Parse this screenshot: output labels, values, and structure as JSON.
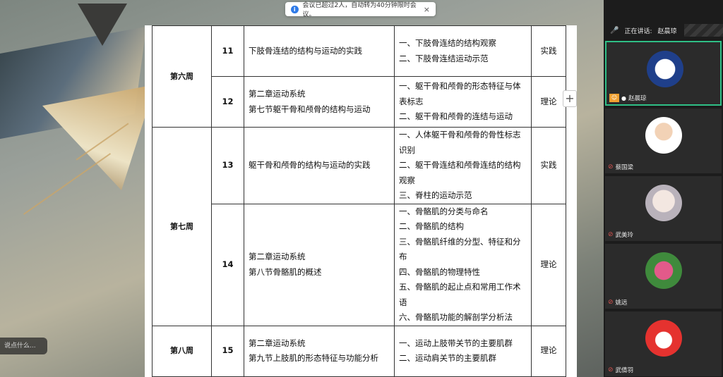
{
  "notification": {
    "text": "会议已超过2人，自动转为40分钟限时会议。",
    "close": "×"
  },
  "share": {
    "comment_placeholder": "说点什么...",
    "add_button": "+"
  },
  "schedule": {
    "rows": [
      {
        "week": "第六周",
        "week_rowspan": 2,
        "num": "11",
        "content": [
          "下肢骨连结的结构与运动的实践"
        ],
        "points": [
          "一、下肢骨连结的结构观察",
          "二、下肢骨连结运动示范"
        ],
        "type": "实践"
      },
      {
        "num": "12",
        "content": [
          "第二章运动系统",
          "第七节躯干骨和颅骨的结构与运动"
        ],
        "points": [
          "一、躯干骨和颅骨的形态特征与体表标志",
          "二、躯干骨和颅骨的连结与运动"
        ],
        "type": "理论"
      },
      {
        "week": "第七周",
        "week_rowspan": 2,
        "num": "13",
        "content": [
          "躯干骨和颅骨的结构与运动的实践"
        ],
        "points": [
          "一、人体躯干骨和颅骨的骨性标志识别",
          "二、躯干骨连结和颅骨连结的结构观察",
          "三、脊柱的运动示范"
        ],
        "type": "实践"
      },
      {
        "num": "14",
        "content": [
          "第二章运动系统",
          "第八节骨骼肌的概述"
        ],
        "points": [
          "一、骨骼肌的分类与命名",
          "二、骨骼肌的结构",
          "三、骨骼肌纤维的分型、特征和分布",
          "四、骨骼肌的物理特性",
          "五、骨骼肌的起止点和常用工作术语",
          "六、骨骼肌功能的解剖学分析法"
        ],
        "type": "理论"
      },
      {
        "week": "第八周",
        "week_rowspan": 1,
        "num": "15",
        "content": [
          "第二章运动系统",
          "第九节上肢肌的形态特征与功能分析"
        ],
        "points": [
          "一、运动上肢带关节的主要肌群",
          "二、运动肩关节的主要肌群"
        ],
        "type": "理论"
      }
    ]
  },
  "panel": {
    "speaking_label": "正在讲话:",
    "speaking_name": "赵晨琼",
    "participants": [
      {
        "name": "赵晨琼",
        "avatar": "school-logo",
        "host": true,
        "muted": false,
        "active": true
      },
      {
        "name": "蔡国梁",
        "avatar": "person-photo",
        "host": false,
        "muted": true,
        "active": false
      },
      {
        "name": "武美玲",
        "avatar": "anime-girl",
        "host": false,
        "muted": true,
        "active": false
      },
      {
        "name": "姚远",
        "avatar": "flower-photo",
        "host": false,
        "muted": true,
        "active": false
      },
      {
        "name": "武倩羽",
        "avatar": "red-toy",
        "host": false,
        "muted": true,
        "active": false
      }
    ],
    "colors": {
      "active_border": "#2fbf86",
      "speaking_mic": "#39c27a",
      "host_badge": "#f0a030"
    }
  }
}
